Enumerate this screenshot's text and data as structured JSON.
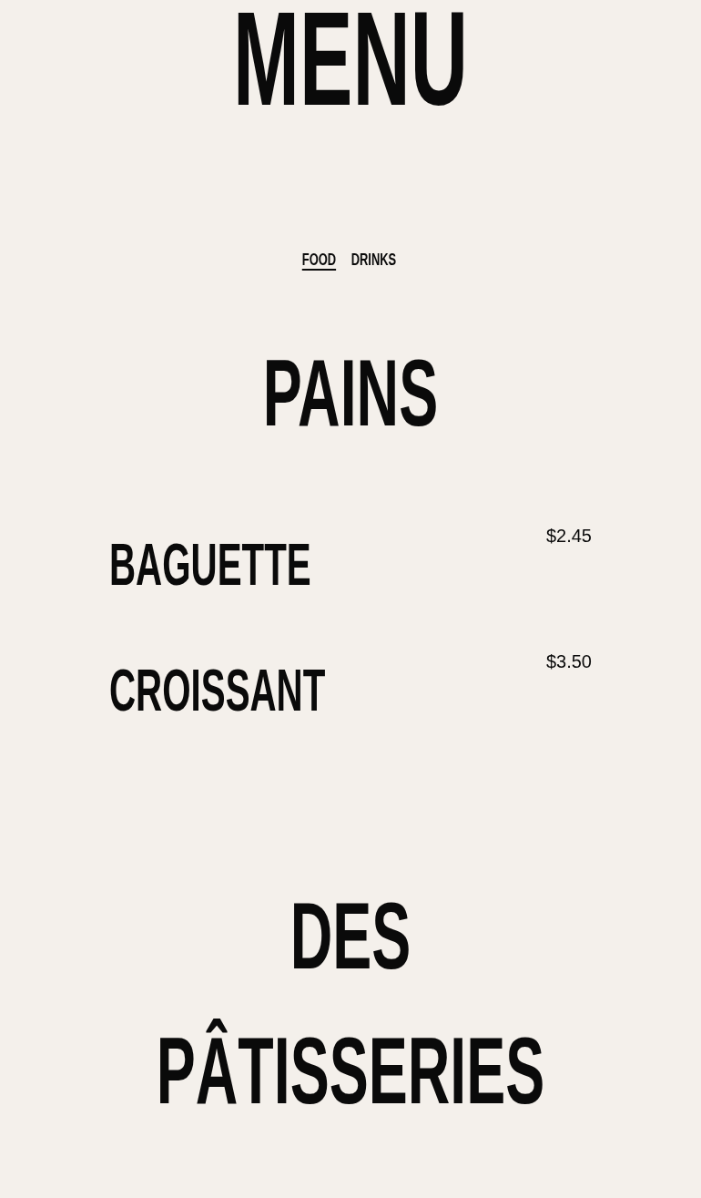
{
  "title": "MENU",
  "tabs": [
    {
      "label": "FOOD",
      "selected": true
    },
    {
      "label": "DRINKS",
      "selected": false
    }
  ],
  "sections": [
    {
      "title": "PAINS",
      "items": [
        {
          "name": "BAGUETTE",
          "price": "$2.45"
        },
        {
          "name": "CROISSANT",
          "price": "$3.50"
        }
      ]
    },
    {
      "title": "DES PÂTISSERIES"
    }
  ]
}
